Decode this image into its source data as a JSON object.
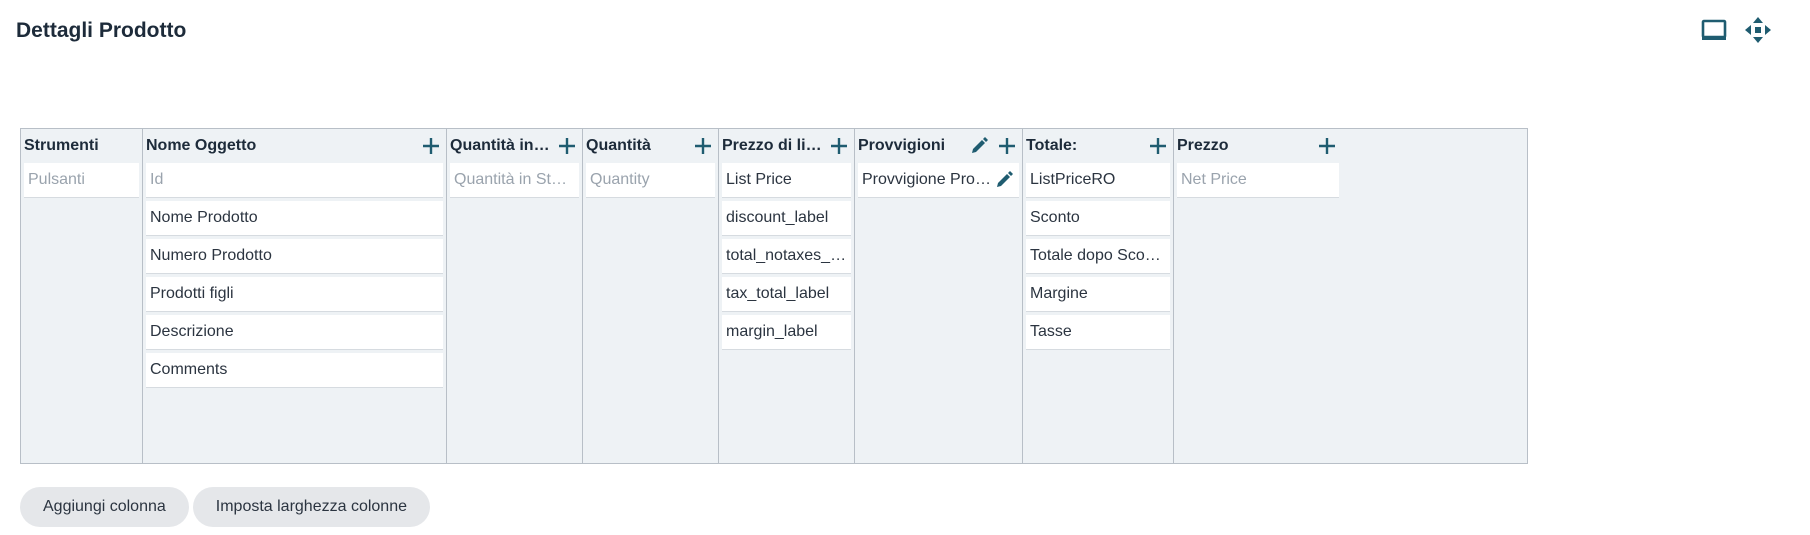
{
  "page": {
    "title": "Dettagli Prodotto"
  },
  "toolbar": {
    "icons": [
      "tablet-icon",
      "move-arrows-icon"
    ]
  },
  "colors": {
    "accent": "#1f5c70",
    "board_bg": "#eef2f5"
  },
  "columns": [
    {
      "header": "Strumenti",
      "has_add": false,
      "has_edit": false,
      "cells": [
        {
          "text": "Pulsanti",
          "placeholder": true
        }
      ]
    },
    {
      "header": "Nome Oggetto",
      "has_add": true,
      "has_edit": false,
      "cells": [
        {
          "text": "Id",
          "placeholder": true
        },
        {
          "text": "Nome Prodotto"
        },
        {
          "text": "Numero Prodotto"
        },
        {
          "text": "Prodotti figli"
        },
        {
          "text": "Descrizione"
        },
        {
          "text": "Comments"
        }
      ]
    },
    {
      "header": "Quantità in St…",
      "has_add": true,
      "has_edit": false,
      "cells": [
        {
          "text": "Quantità in Stock",
          "placeholder": true
        }
      ]
    },
    {
      "header": "Quantità",
      "has_add": true,
      "has_edit": false,
      "cells": [
        {
          "text": "Quantity",
          "placeholder": true
        }
      ]
    },
    {
      "header": "Prezzo di listino",
      "has_add": true,
      "has_edit": false,
      "cells": [
        {
          "text": "List Price"
        },
        {
          "text": "discount_label"
        },
        {
          "text": "total_notaxes_label"
        },
        {
          "text": "tax_total_label"
        },
        {
          "text": "margin_label"
        }
      ]
    },
    {
      "header": "Provvigioni",
      "has_add": true,
      "has_edit": true,
      "cells": [
        {
          "text": "Provvigione Prodotto",
          "edit": true
        }
      ]
    },
    {
      "header": "Totale:",
      "has_add": true,
      "has_edit": false,
      "cells": [
        {
          "text": "ListPriceRO"
        },
        {
          "text": "Sconto"
        },
        {
          "text": "Totale dopo Sconto"
        },
        {
          "text": "Margine"
        },
        {
          "text": "Tasse"
        }
      ]
    },
    {
      "header": "Prezzo",
      "has_add": true,
      "has_edit": false,
      "cells": [
        {
          "text": "Net Price",
          "placeholder": true
        }
      ]
    }
  ],
  "buttons": {
    "add_column": "Aggiungi colonna",
    "set_width": "Imposta larghezza colonne"
  }
}
